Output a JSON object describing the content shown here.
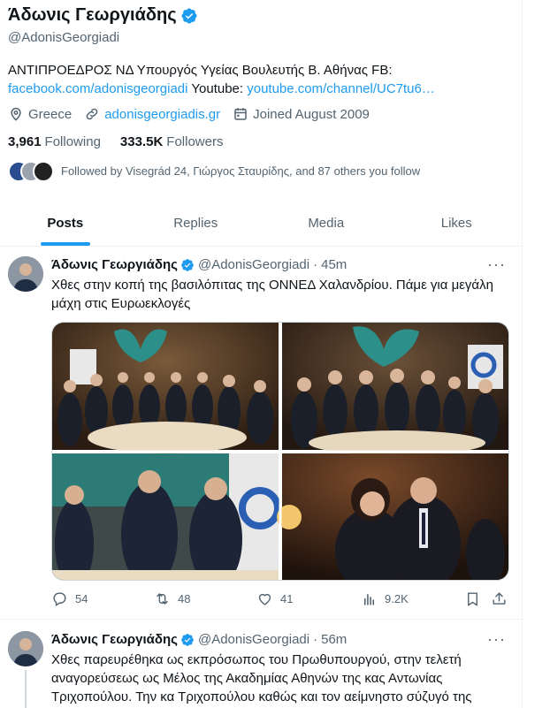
{
  "profile": {
    "name": "Άδωνις Γεωργιάδης",
    "handle": "@AdonisGeorgiadi",
    "bio_text": "ΑΝΤΙΠΡΟΕΔΡΟΣ ΝΔ Υπουργός Υγείας Βουλευτής Β. Αθήνας FB:",
    "bio_fb_link": "facebook.com/adonisgeorgiadi",
    "bio_youtube_label": "Youtube:",
    "bio_youtube_link": "youtube.com/channel/UC7tu6…",
    "location": "Greece",
    "website": "adonisgeorgiadis.gr",
    "joined": "Joined August 2009",
    "following_count": "3,961",
    "following_label": "Following",
    "followers_count": "333.5K",
    "followers_label": "Followers",
    "followed_by": "Followed by Visegrád 24, Γιώργος Σταυρίδης, and 87 others you follow"
  },
  "tabs": [
    {
      "label": "Posts",
      "active": true
    },
    {
      "label": "Replies",
      "active": false
    },
    {
      "label": "Media",
      "active": false
    },
    {
      "label": "Likes",
      "active": false
    }
  ],
  "tweets": [
    {
      "name": "Άδωνις Γεωργιάδης",
      "handle": "@AdonisGeorgiadi",
      "sep": "·",
      "time": "45m",
      "text": "Χθες στην κοπή της βασιλόπιτας της ΟΝΝΕΔ Χαλανδρίου. Πάμε για μεγάλη μάχη στις Ευρωεκλογές",
      "replies": "54",
      "retweets": "48",
      "likes": "41",
      "views": "9.2K"
    },
    {
      "name": "Άδωνις Γεωργιάδης",
      "handle": "@AdonisGeorgiadi",
      "sep": "·",
      "time": "56m",
      "text": "Χθες παρευρέθηκα ως εκπρόσωπος του Πρωθυπουργού, στην τελετή αναγορεύσεως ως Μέλος της Ακαδημίας Αθηνών της κας Αντωνίας Τριχοπούλου. Την κα Τριχοπούλου καθώς και τον αείμνηστο σύζυγό της"
    }
  ],
  "more_glyph": "···",
  "colors": {
    "accent": "#1d9bf0",
    "secondary_text": "#536471",
    "primary_text": "#0f1419",
    "border": "#eff3f4"
  },
  "icons": [
    "verified-badge-icon",
    "location-pin-icon",
    "link-icon",
    "calendar-icon",
    "reply-icon",
    "retweet-icon",
    "like-icon",
    "views-icon",
    "bookmark-icon",
    "share-icon",
    "more-icon"
  ]
}
